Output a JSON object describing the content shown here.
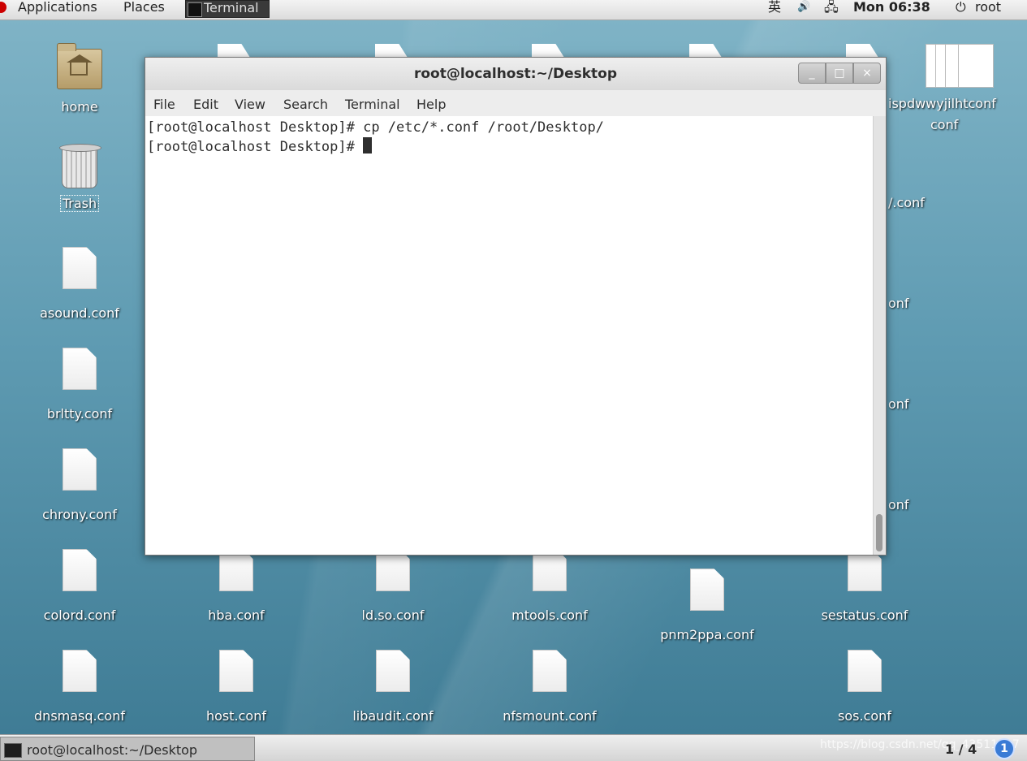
{
  "topbar": {
    "applications": "Applications",
    "places": "Places",
    "active_task": "Terminal",
    "input_method": "英",
    "volume": "🔊",
    "network": "🖧",
    "clock": "Mon 06:38",
    "user_icon": "⏻",
    "user": "root"
  },
  "desktop_icons": {
    "home": "home",
    "trash": "Trash",
    "asound": "asound.conf",
    "brltty": "brltty.conf",
    "chrony": "chrony.conf",
    "colord": "colord.conf",
    "dnsmasq": "dnsmasq.conf",
    "hba": "hba.conf",
    "host": "host.conf",
    "ldso": "ld.so.conf",
    "libaudit": "libaudit.conf",
    "mtools": "mtools.conf",
    "nfsmount": "nfsmount.conf",
    "pnm2ppa": "pnm2ppa.conf",
    "sestatus": "sestatus.conf",
    "sos": "sos.conf",
    "stack_label": "ispdwwyjilhtconf",
    "stack_label2": "conf",
    "partial_1": "/.conf",
    "partial_2": "onf",
    "partial_3": "onf",
    "partial_4": "onf"
  },
  "terminal": {
    "title": "root@localhost:~/Desktop",
    "menu": [
      "File",
      "Edit",
      "View",
      "Search",
      "Terminal",
      "Help"
    ],
    "line1": "[root@localhost Desktop]# cp /etc/*.conf /root/Desktop/",
    "line2": "[root@localhost Desktop]# ",
    "btn_min": "_",
    "btn_max": "□",
    "btn_close": "×"
  },
  "bottombar": {
    "task": "root@localhost:~/Desktop",
    "watermark": "https://blog.csdn.net/qq_43511217",
    "workspace": "1 / 4",
    "notifications": "1"
  }
}
